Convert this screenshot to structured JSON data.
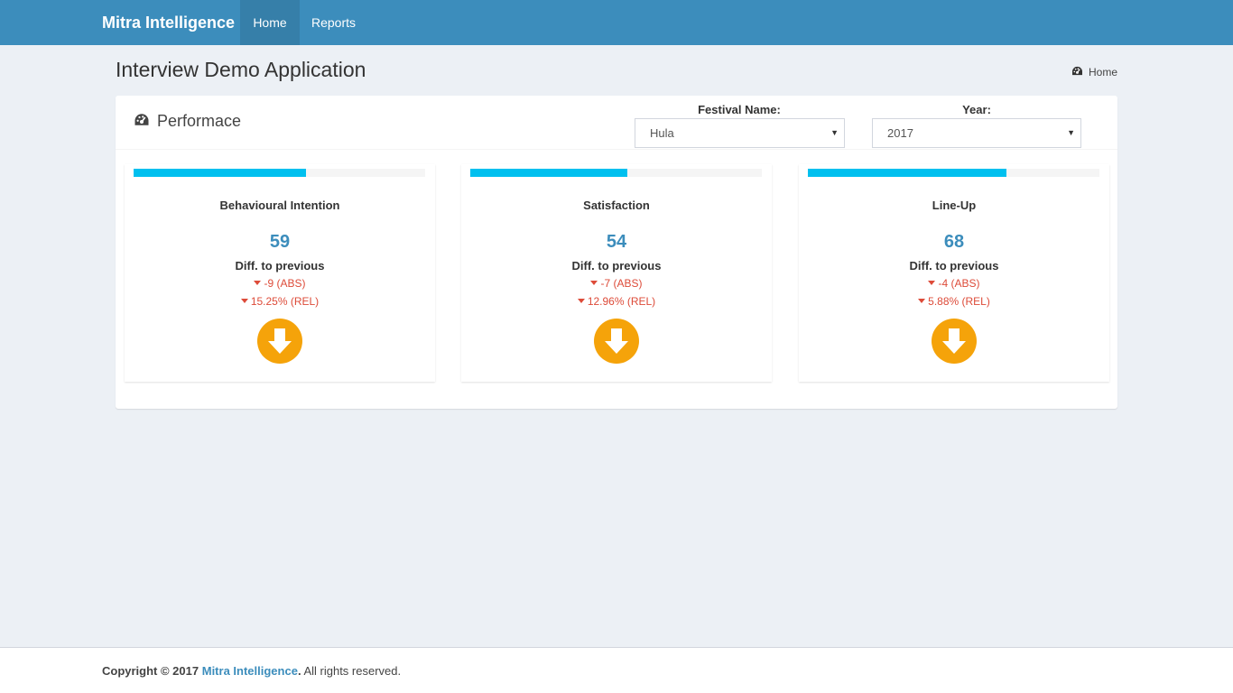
{
  "navbar": {
    "brand": "Mitra Intelligence",
    "items": [
      {
        "label": "Home",
        "active": true
      },
      {
        "label": "Reports",
        "active": false
      }
    ],
    "color": "#3c8dbc"
  },
  "header": {
    "title": "Interview Demo Application",
    "breadcrumb": {
      "icon": "dashboard-icon",
      "label": "Home"
    }
  },
  "box": {
    "title": "Performace",
    "title_icon": "dashboard-icon",
    "filters": {
      "festival": {
        "label": "Festival Name:",
        "value": "Hula"
      },
      "year": {
        "label": "Year:",
        "value": "2017"
      }
    }
  },
  "cards": [
    {
      "title": "Behavioural Intention",
      "value": "59",
      "progress": 0.59,
      "diff_label": "Diff. to previous",
      "abs": "-9 (ABS)",
      "rel": "15.25% (REL)",
      "icon": "arrow-down-circle-icon"
    },
    {
      "title": "Satisfaction",
      "value": "54",
      "progress": 0.54,
      "diff_label": "Diff. to previous",
      "abs": "-7 (ABS)",
      "rel": "12.96% (REL)",
      "icon": "arrow-down-circle-icon"
    },
    {
      "title": "Line-Up",
      "value": "68",
      "progress": 0.68,
      "diff_label": "Diff. to previous",
      "abs": "-4 (ABS)",
      "rel": "5.88% (REL)",
      "icon": "arrow-down-circle-icon"
    }
  ],
  "colors": {
    "progress": "#00c0ef",
    "value": "#3c8dbc",
    "negative": "#dd4b39",
    "arrow": "#f5a30a"
  },
  "footer": {
    "prefix": "Copyright © 2017",
    "link": "Mitra Intelligence",
    "suffix": ". All rights reserved."
  }
}
